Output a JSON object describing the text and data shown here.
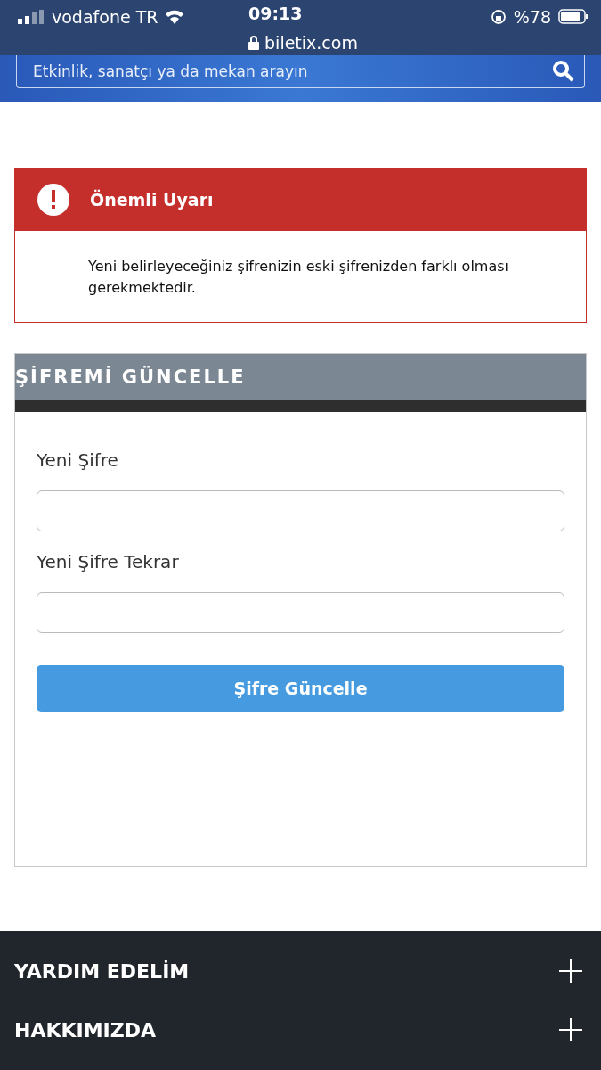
{
  "status_bar": {
    "carrier": "vodafone TR",
    "time": "09:13",
    "battery": "%78",
    "url": "biletix.com"
  },
  "search": {
    "placeholder": "Etkinlik, sanatçı ya da mekan arayın"
  },
  "alert": {
    "title": "Önemli Uyarı",
    "message": "Yeni belirleyeceğiniz şifrenizin eski şifrenizden farklı olması gerekmektedir."
  },
  "form": {
    "title": "ŞİFREMİ GÜNCELLE",
    "fields": [
      {
        "label": "Yeni Şifre"
      },
      {
        "label": "Yeni Şifre Tekrar"
      }
    ],
    "submit": "Şifre Güncelle"
  },
  "footer": {
    "sections": [
      {
        "label": "YARDIM EDELİM",
        "expanded": false
      },
      {
        "label": "HAKKIMIZDA",
        "expanded": false
      }
    ]
  }
}
